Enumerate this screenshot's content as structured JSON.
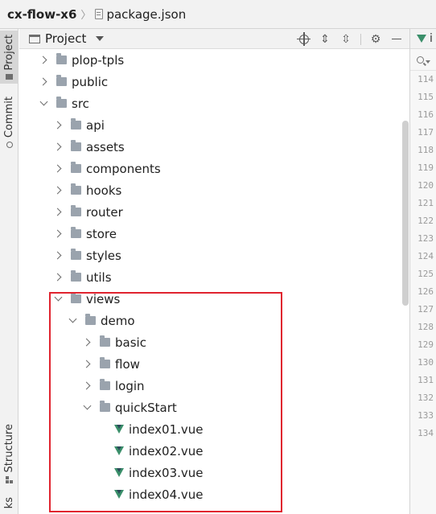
{
  "breadcrumb": {
    "project": "cx-flow-x6",
    "file": "package.json"
  },
  "left_strip": {
    "tabs": [
      "Project",
      "Commit",
      "Structure",
      "ks"
    ]
  },
  "tool_window": {
    "title": "Project"
  },
  "tree": {
    "items": [
      {
        "label": "plop-tpls",
        "type": "folder",
        "level": 1,
        "expanded": false
      },
      {
        "label": "public",
        "type": "folder",
        "level": 1,
        "expanded": false
      },
      {
        "label": "src",
        "type": "folder",
        "level": 1,
        "expanded": true
      },
      {
        "label": "api",
        "type": "folder",
        "level": 2,
        "expanded": false
      },
      {
        "label": "assets",
        "type": "folder",
        "level": 2,
        "expanded": false
      },
      {
        "label": "components",
        "type": "folder",
        "level": 2,
        "expanded": false
      },
      {
        "label": "hooks",
        "type": "folder",
        "level": 2,
        "expanded": false
      },
      {
        "label": "router",
        "type": "folder",
        "level": 2,
        "expanded": false
      },
      {
        "label": "store",
        "type": "folder",
        "level": 2,
        "expanded": false
      },
      {
        "label": "styles",
        "type": "folder",
        "level": 2,
        "expanded": false
      },
      {
        "label": "utils",
        "type": "folder",
        "level": 2,
        "expanded": false
      },
      {
        "label": "views",
        "type": "folder",
        "level": 2,
        "expanded": true
      },
      {
        "label": "demo",
        "type": "folder",
        "level": 3,
        "expanded": true
      },
      {
        "label": "basic",
        "type": "folder",
        "level": 4,
        "expanded": false
      },
      {
        "label": "flow",
        "type": "folder",
        "level": 4,
        "expanded": false
      },
      {
        "label": "login",
        "type": "folder",
        "level": 4,
        "expanded": false
      },
      {
        "label": "quickStart",
        "type": "folder",
        "level": 4,
        "expanded": true
      },
      {
        "label": "index01.vue",
        "type": "vue",
        "level": 5
      },
      {
        "label": "index02.vue",
        "type": "vue",
        "level": 5
      },
      {
        "label": "index03.vue",
        "type": "vue",
        "level": 5
      },
      {
        "label": "index04.vue",
        "type": "vue",
        "level": 5
      }
    ]
  },
  "editor": {
    "tab_label": "i",
    "gutter_lines": [
      "114",
      "115",
      "116",
      "117",
      "118",
      "119",
      "120",
      "121",
      "122",
      "123",
      "124",
      "125",
      "126",
      "127",
      "128",
      "129",
      "130",
      "131",
      "132",
      "133",
      "134"
    ]
  },
  "colors": {
    "highlight": "#e0242f",
    "vue_green": "#3a8f6a",
    "folder": "#9aa3ad"
  }
}
